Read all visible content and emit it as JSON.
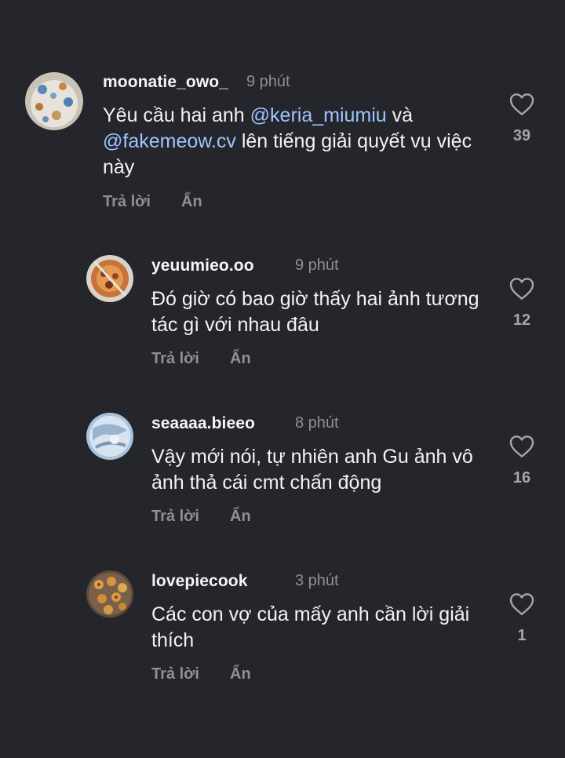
{
  "comments": [
    {
      "username": "moonatie_owo_",
      "time": "9 phút",
      "text_parts": {
        "t1": "Yêu cầu hai anh ",
        "m1": "@keria_miumiu",
        "t2": " và ",
        "m2": "@fakemeow.cv",
        "t3": " lên tiếng giải quyết vụ việc này"
      },
      "reply_label": "Trả lời",
      "hide_label": "Ẩn",
      "likes": "39",
      "icon": "heart-outline-icon"
    },
    {
      "username": "yeuumieo.oo",
      "time": "9 phút",
      "text": "Đó giờ có bao giờ thấy hai ảnh tương tác gì với nhau đâu",
      "reply_label": "Trả lời",
      "hide_label": "Ẩn",
      "likes": "12",
      "icon": "heart-outline-icon"
    },
    {
      "username": "seaaaa.bieeo",
      "time": "8 phút",
      "text": "Vậy mới nói, tự nhiên anh Gu ảnh vô ảnh thả cái cmt chấn động",
      "reply_label": "Trả lời",
      "hide_label": "Ẩn",
      "likes": "16",
      "icon": "heart-outline-icon"
    },
    {
      "username": "lovepiecook",
      "time": "3 phút",
      "text": "Các con vợ của mấy anh cần lời giải thích",
      "reply_label": "Trả lời",
      "hide_label": "Ẩn",
      "likes": "1",
      "icon": "heart-outline-icon"
    }
  ],
  "colors": {
    "background": "#24262b",
    "mention": "#9ec3ff",
    "secondary_text": "#8e9096"
  }
}
